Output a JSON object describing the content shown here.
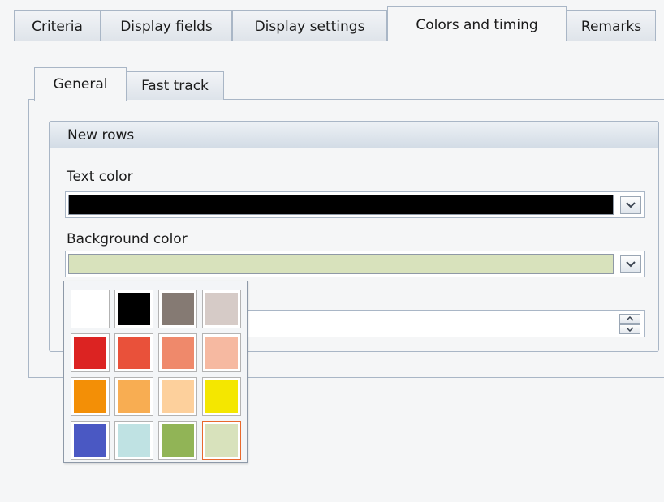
{
  "tabs": [
    {
      "label": "Criteria",
      "active": false
    },
    {
      "label": "Display fields",
      "active": false
    },
    {
      "label": "Display settings",
      "active": false
    },
    {
      "label": "Colors and timing",
      "active": true
    },
    {
      "label": "Remarks",
      "active": false
    }
  ],
  "subtabs": [
    {
      "label": "General",
      "active": true
    },
    {
      "label": "Fast track",
      "active": false
    }
  ],
  "group": {
    "title": "New rows",
    "text_color_label": "Text color",
    "text_color_value": "#000000",
    "background_color_label": "Background color",
    "background_color_value": "#d8e2bc",
    "spin_value": ""
  },
  "palette": {
    "colors": [
      "#ffffff",
      "#000000",
      "#857a73",
      "#d6cbc7",
      "#dc2322",
      "#e9513a",
      "#ef896b",
      "#f6b9a1",
      "#f38f06",
      "#f8ad52",
      "#fdd09c",
      "#f4e700",
      "#4a58c3",
      "#bfe2e3",
      "#91b456",
      "#d8e2bc"
    ],
    "selected": "#d8e2bc"
  },
  "colors": {
    "border": "#a9b6c6",
    "panel_bg": "#f5f6f7",
    "selection_border": "#e8692d"
  },
  "icons": {
    "dropdown": "chevron-down-icon",
    "spin_up": "chevron-up-icon",
    "spin_down": "chevron-down-icon"
  }
}
